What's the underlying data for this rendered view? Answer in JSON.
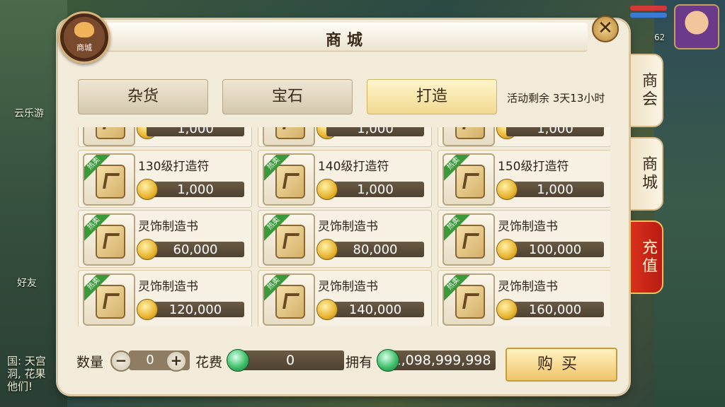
{
  "background": {
    "left_labels": [
      "云乐游",
      "好友"
    ],
    "chat_lines": [
      "国: 天宫",
      "洞, 花果",
      "他们!"
    ],
    "right_level": "62"
  },
  "header": {
    "title": "商城",
    "badge_label": "商城",
    "close_glyph": "✕"
  },
  "tabs": [
    {
      "label": "杂货",
      "active": false
    },
    {
      "label": "宝石",
      "active": false
    },
    {
      "label": "打造",
      "active": true
    }
  ],
  "timer_text": "活动剩余 3天13小时",
  "side_tabs": [
    {
      "label": "商会"
    },
    {
      "label": "商城"
    },
    {
      "label": "充值"
    }
  ],
  "items_partial": [
    {
      "price": "1,000"
    },
    {
      "price": "1,000"
    },
    {
      "price": "1,000"
    }
  ],
  "items": [
    {
      "name": "130级打造符",
      "price": "1,000",
      "tag": "热卖"
    },
    {
      "name": "140级打造符",
      "price": "1,000",
      "tag": "热卖"
    },
    {
      "name": "150级打造符",
      "price": "1,000",
      "tag": "热卖"
    },
    {
      "name": "灵饰制造书",
      "price": "60,000",
      "tag": "热卖"
    },
    {
      "name": "灵饰制造书",
      "price": "80,000",
      "tag": "热卖"
    },
    {
      "name": "灵饰制造书",
      "price": "100,000",
      "tag": "热卖"
    },
    {
      "name": "灵饰制造书",
      "price": "120,000",
      "tag": "热卖"
    },
    {
      "name": "灵饰制造书",
      "price": "140,000",
      "tag": "热卖"
    },
    {
      "name": "灵饰制造书",
      "price": "160,000",
      "tag": "热卖"
    }
  ],
  "bottom": {
    "qty_label": "数量",
    "qty_value": "0",
    "minus": "−",
    "plus": "+",
    "cost_label": "花费",
    "cost_value": "0",
    "own_label": "拥有",
    "own_value": "1,098,999,998",
    "buy_label": "购买"
  }
}
